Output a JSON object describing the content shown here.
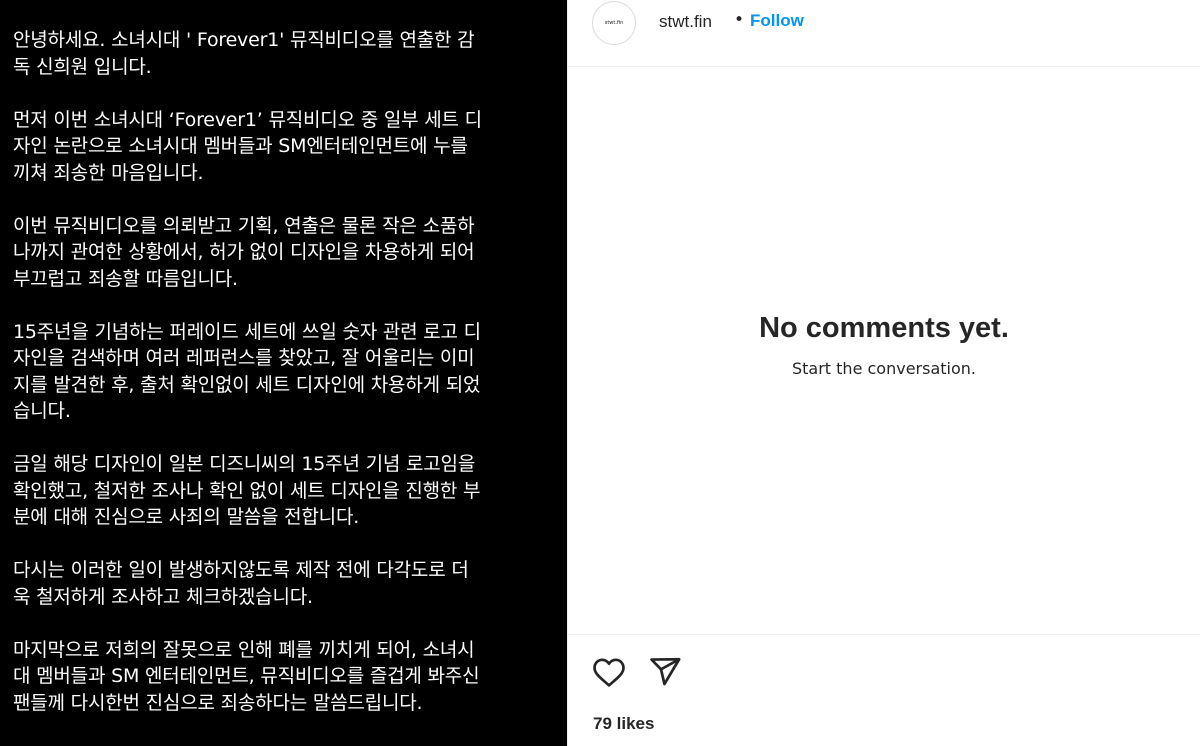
{
  "post": {
    "paragraphs": [
      [
        "안녕하세요. 소녀시대 ' Forever1' 뮤직비디오를 연출한 감",
        "독 신희원 입니다."
      ],
      [
        "먼저 이번 소녀시대 ‘Forever1’ 뮤직비디오 중 일부 세트 디",
        "자인 논란으로 소녀시대 멤버들과 SM엔터테인먼트에 누를",
        "끼쳐 죄송한 마음입니다."
      ],
      [
        "이번 뮤직비디오를 의뢰받고 기획, 연출은 물론 작은 소품하",
        "나까지 관여한 상황에서, 허가 없이 디자인을 차용하게 되어",
        "부끄럽고 죄송할 따름입니다."
      ],
      [
        "15주년을 기념하는 퍼레이드 세트에 쓰일 숫자 관련 로고 디",
        "자인을 검색하며 여러 레퍼런스를 찾았고, 잘 어울리는 이미",
        "지를 발견한 후, 출처 확인없이 세트 디자인에 차용하게 되었",
        "습니다."
      ],
      [
        "금일 해당 디자인이 일본 디즈니씨의 15주년 기념 로고임을",
        "확인했고, 철저한 조사나 확인 없이 세트 디자인을 진행한 부",
        "분에 대해 진심으로 사죄의 말씀을 전합니다."
      ],
      [
        "다시는 이러한 일이 발생하지않도록 제작 전에 다각도로 더",
        "욱 철저하게 조사하고 체크하겠습니다."
      ],
      [
        "마지막으로 저희의 잘못으로 인해 폐를 끼치게 되어, 소녀시",
        "대 멤버들과 SM 엔터테인먼트, 뮤직비디오를 즐겁게 봐주신",
        "팬들께 다시한번 진심으로 죄송하다는 말씀드립니다."
      ]
    ]
  },
  "header": {
    "avatar_text": "stwt.fin",
    "username": "stwt.fin",
    "separator": "•",
    "follow_label": "Follow",
    "follow_color": "#0095f6"
  },
  "comments": {
    "empty_title": "No comments yet.",
    "empty_subtitle": "Start the conversation."
  },
  "actions": {
    "like_icon": "heart-icon",
    "share_icon": "paper-plane-icon",
    "likes_count": "79",
    "likes_word": "likes"
  }
}
